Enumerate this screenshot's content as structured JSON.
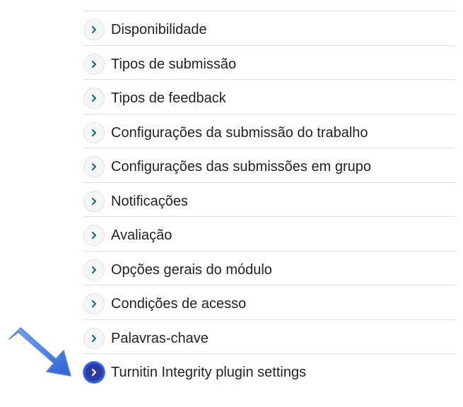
{
  "sections": [
    {
      "title": "Disponibilidade",
      "toggle_icon": "chevron-right-icon"
    },
    {
      "title": "Tipos de submissão",
      "toggle_icon": "chevron-right-icon"
    },
    {
      "title": "Tipos de feedback",
      "toggle_icon": "chevron-right-icon"
    },
    {
      "title": "Configurações da submissão do trabalho",
      "toggle_icon": "chevron-right-icon"
    },
    {
      "title": "Configurações das submissões em grupo",
      "toggle_icon": "chevron-right-icon"
    },
    {
      "title": "Notificações",
      "toggle_icon": "chevron-right-icon"
    },
    {
      "title": "Avaliação",
      "toggle_icon": "chevron-right-icon"
    },
    {
      "title": "Opções gerais do módulo",
      "toggle_icon": "chevron-right-icon"
    },
    {
      "title": "Condições de acesso",
      "toggle_icon": "chevron-right-icon"
    },
    {
      "title": "Palavras-chave",
      "toggle_icon": "chevron-right-icon"
    },
    {
      "title": "Turnitin Integrity plugin settings",
      "toggle_icon": "chevron-right-icon",
      "highlighted": true
    }
  ],
  "colors": {
    "toggle_bg": "#f5f6f8",
    "chevron": "#0f6e7f",
    "active_toggle_bg": "#2c3aa6",
    "text": "#1d2125",
    "divider": "#dee2e6",
    "arrow": "#4a7fe8"
  },
  "annotation": {
    "icon": "pointer-arrow-icon"
  }
}
